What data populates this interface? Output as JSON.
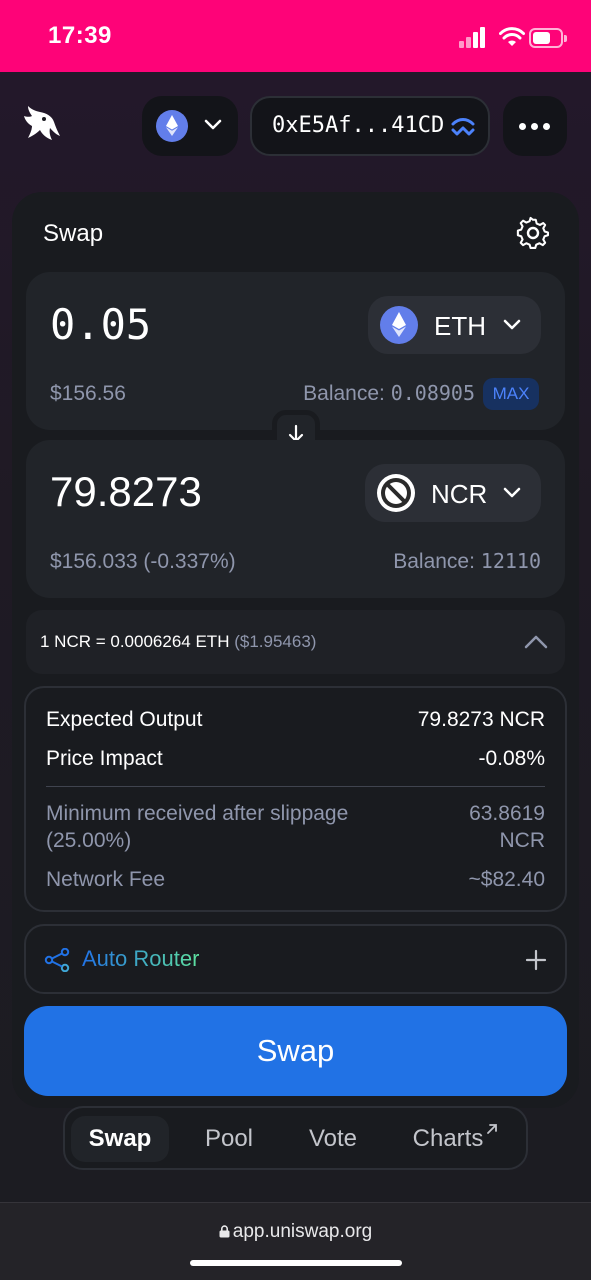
{
  "status_bar": {
    "time": "17:39",
    "color": "#fe0378"
  },
  "header": {
    "network_icon": "ethereum-icon",
    "address": "0xE5Af...41CD"
  },
  "swap": {
    "title": "Swap",
    "input": {
      "amount": "0.05",
      "token": "ETH",
      "fiat": "$156.56",
      "balance_label": "Balance: ",
      "balance_value": "0.08905",
      "max_label": "MAX"
    },
    "output": {
      "amount": "79.8273",
      "token": "NCR",
      "fiat": "$156.033 (-0.337%)",
      "balance_label": "Balance: ",
      "balance_value": "12110"
    },
    "rate": {
      "text": "1 NCR = 0.0006264 ETH",
      "usd": "($1.95463)"
    },
    "details": {
      "expected_output_label": "Expected Output",
      "expected_output_value": "79.8273 NCR",
      "price_impact_label": "Price Impact",
      "price_impact_value": "-0.08%",
      "min_received_label_1": "Minimum received after slippage",
      "min_received_label_2": "(25.00%)",
      "min_received_value_1": "63.8619",
      "min_received_value_2": "NCR",
      "network_fee_label": "Network Fee",
      "network_fee_value": "~$82.40"
    },
    "router_label": "Auto Router",
    "swap_button": "Swap"
  },
  "nav": {
    "items": [
      {
        "label": "Swap"
      },
      {
        "label": "Pool"
      },
      {
        "label": "Vote"
      },
      {
        "label": "Charts"
      }
    ]
  },
  "browser": {
    "url": "app.uniswap.org"
  },
  "colors": {
    "accent": "#2172e5",
    "eth": "#627eea",
    "max_bg": "#173160"
  }
}
